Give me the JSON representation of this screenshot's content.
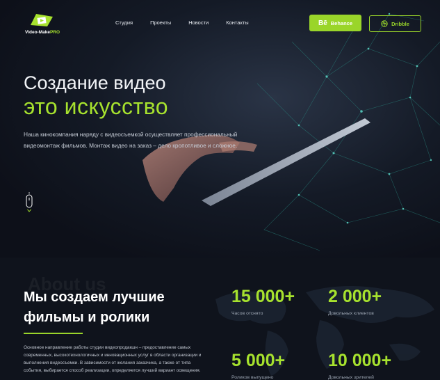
{
  "logo": {
    "text_main": "Video-Make",
    "text_accent": "PRO"
  },
  "nav": {
    "items": [
      "Студия",
      "Проекты",
      "Новости",
      "Контакты"
    ]
  },
  "buttons": {
    "behance": "Behance",
    "behance_mark": "Bē",
    "dribble": "Dribble"
  },
  "hero": {
    "title_line1": "Создание видео",
    "title_line2": "это искусство",
    "lead": "Наша кинокомпания наряду с видеосъемкой осуществляет профессиональный видеомонтаж фильмов. Монтаж видео на заказ – дело кропотливое и сложное."
  },
  "about": {
    "bg_word": "About us",
    "title": "Мы создаем лучшие фильмы и ролики",
    "text": "Основное направление работы студии видеопродакшн – предоставление самых современных, высокотехнологичных и инновационных услуг в области организации и выполнения видеосъемки. В зависимости от желания заказчика, а также от типа события, выбирается способ реализации, определяется лучший вариант освещения."
  },
  "stats": [
    {
      "value": "15 000+",
      "label": "Часов отснято"
    },
    {
      "value": "2 000+",
      "label": "Довольных клиентов"
    },
    {
      "value": "5 000+",
      "label": "Роликов выпущено"
    },
    {
      "value": "10 000+",
      "label": "Довольных зрителей"
    }
  ],
  "colors": {
    "accent": "#a7e22e",
    "button": "#9ad52a",
    "background": "#0f131c"
  }
}
